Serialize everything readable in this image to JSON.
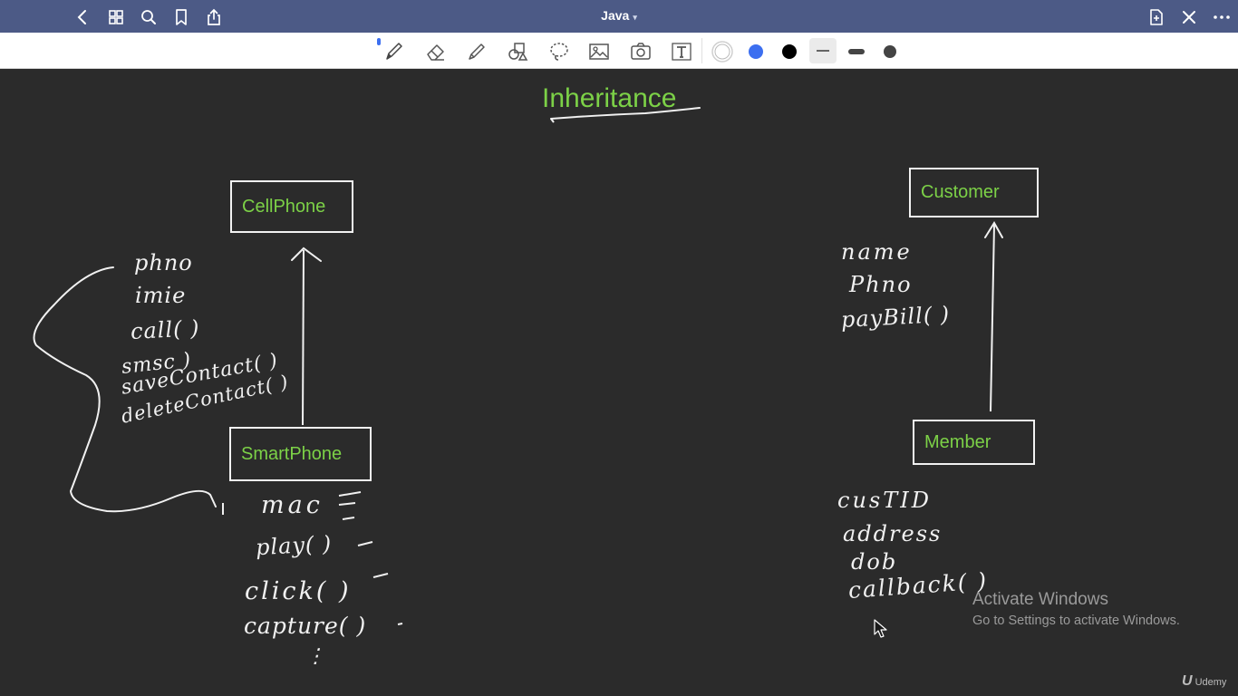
{
  "app": {
    "title": "Java"
  },
  "topbar": {
    "left_icons": [
      "back-icon",
      "grid-icon",
      "search-icon",
      "bookmark-icon",
      "share-icon"
    ],
    "right_icons": [
      "add-page-icon",
      "close-icon",
      "more-icon"
    ]
  },
  "toolbar": {
    "tools": [
      "pen-icon",
      "eraser-icon",
      "highlighter-icon",
      "shapes-icon",
      "lasso-icon",
      "image-icon",
      "camera-icon",
      "text-icon"
    ],
    "colors": [
      "#ffffff",
      "#3c6ff0",
      "#000000"
    ],
    "stroke_widths": [
      "thin",
      "medium",
      "thick"
    ]
  },
  "note": {
    "heading": "Inheritance",
    "left_diagram": {
      "parent": "CellPhone",
      "child": "SmartPhone",
      "parent_members": [
        "phno",
        "imie",
        "call( )",
        "smsc )",
        "saveContact( )",
        "deleteContact( )"
      ],
      "child_members": [
        "mac",
        "play( )",
        "click( )",
        "capture( )",
        "⋮"
      ]
    },
    "right_diagram": {
      "parent": "Customer",
      "child": "Member",
      "parent_members": [
        "name",
        "Phno",
        "payBill( )"
      ],
      "child_members": [
        "cusTID",
        "address",
        "dob",
        "callback( )"
      ]
    }
  },
  "overlay": {
    "activate_title": "Activate Windows",
    "activate_sub": "Go to Settings to activate Windows.",
    "watermark": "Udemy"
  },
  "colors": {
    "topbar": "#4c5a86",
    "canvas": "#2b2b2b",
    "accent_green": "#7cd147",
    "ink": "#f1f1f1"
  }
}
